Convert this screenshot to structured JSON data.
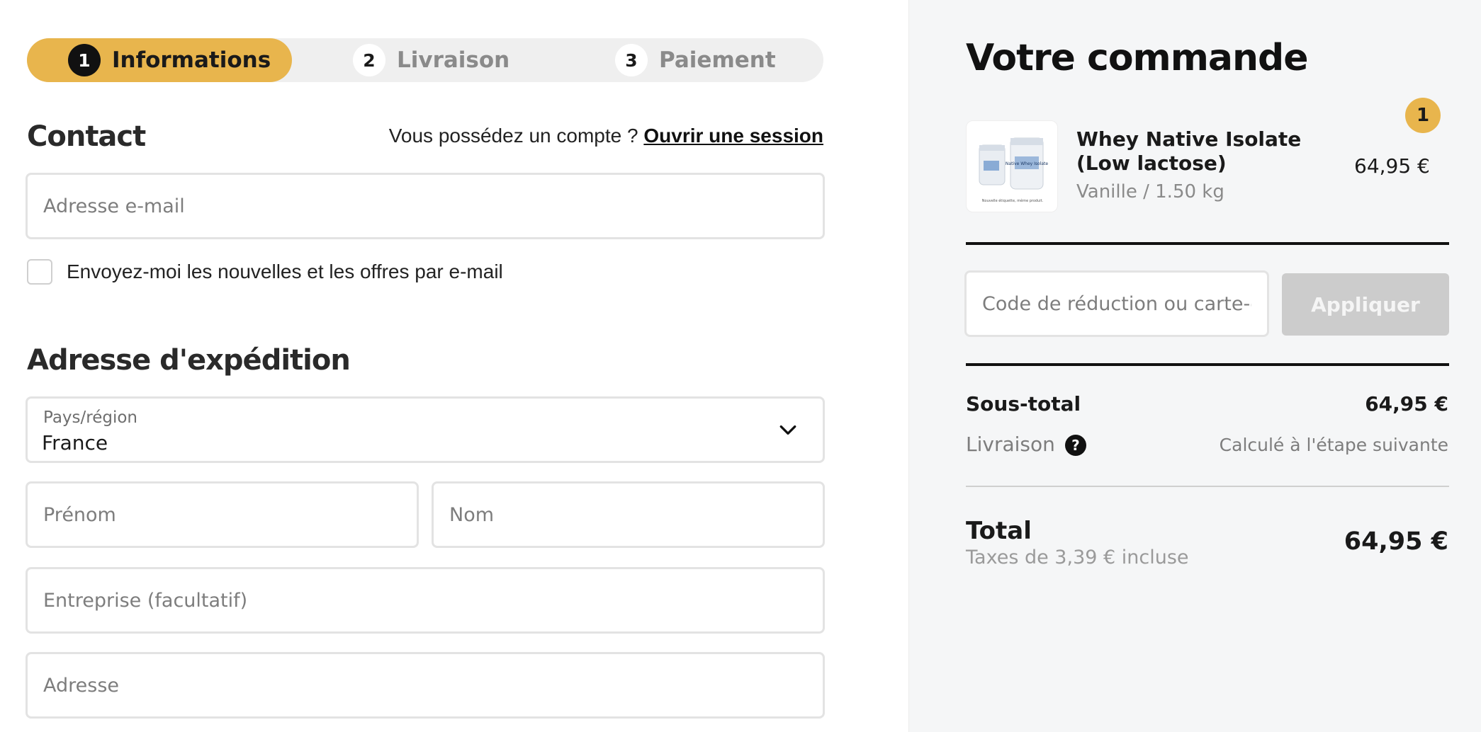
{
  "stepper": {
    "steps": [
      {
        "number": "1",
        "label": "Informations"
      },
      {
        "number": "2",
        "label": "Livraison"
      },
      {
        "number": "3",
        "label": "Paiement"
      }
    ]
  },
  "contact": {
    "title": "Contact",
    "account_prompt": "Vous possédez un compte ? ",
    "login_link": "Ouvrir une session",
    "email_placeholder": "Adresse e-mail",
    "newsletter_label": "Envoyez-moi les nouvelles et les offres par e-mail"
  },
  "shipping": {
    "title": "Adresse d'expédition",
    "country_label": "Pays/région",
    "country_value": "France",
    "first_name_placeholder": "Prénom",
    "last_name_placeholder": "Nom",
    "company_placeholder": "Entreprise (facultatif)",
    "address_placeholder": "Adresse"
  },
  "order": {
    "title": "Votre commande",
    "product": {
      "name": "Whey Native Isolate (Low lactose)",
      "variant": "Vanille / 1.50 kg",
      "price": "64,95 €",
      "quantity": "1",
      "image_label": "Native Whey Isolate",
      "image_caption": "Nouvelle étiquette, même produit."
    },
    "discount_placeholder": "Code de réduction ou carte-cadeau",
    "apply_label": "Appliquer",
    "subtotal_label": "Sous-total",
    "subtotal_value": "64,95 €",
    "shipping_label": "Livraison",
    "shipping_value": "Calculé à l'étape suivante",
    "total_label": "Total",
    "total_value": "64,95 €",
    "taxes_note": "Taxes de 3,39 € incluse"
  },
  "colors": {
    "accent": "#e8b54d",
    "panel_bg": "#f5f6f7",
    "button_disabled": "#cccccc"
  }
}
